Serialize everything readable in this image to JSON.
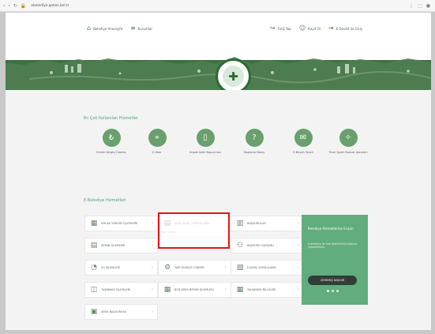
{
  "browser": {
    "url": "ebelediye.gebze.bel.tr",
    "icons": [
      "back-icon",
      "forward-icon",
      "refresh-icon",
      "lock-icon",
      "more-icon",
      "extensions-icon",
      "profile-icon"
    ]
  },
  "topnav": {
    "left": [
      {
        "label": "Belediye Anasayfa",
        "icon": "home-icon"
      },
      {
        "label": "Kurumlar",
        "icon": "menu-icon"
      }
    ],
    "right": [
      {
        "label": "Giriş Yap",
        "icon": "login-icon"
      },
      {
        "label": "Kayıt Ol",
        "icon": "user-plus-icon"
      },
      {
        "label": "E-Devlet ile Giriş",
        "icon": "edevlet-icon"
      }
    ]
  },
  "hero": {
    "seal_icon": "seal-logo-icon"
  },
  "sections": {
    "most_used_title": "En Çok Kullanılan Hizmetler",
    "ebelediye_title": "E-Belediye Hizmetleri"
  },
  "services": [
    {
      "label": "Emlak Vergisi Ödeme",
      "icon": "payment-icon"
    },
    {
      "label": "E-İmar",
      "icon": "location-icon"
    },
    {
      "label": "İnşaat İşleri Başvurusu",
      "icon": "document-icon"
    },
    {
      "label": "Başkana Danış",
      "icon": "question-icon"
    },
    {
      "label": "E-Beyan Tahsil",
      "icon": "chat-icon"
    },
    {
      "label": "Ticari İşyeri Ruhsat İşlemleri",
      "icon": "business-icon"
    }
  ],
  "e_services": {
    "col1": [
      {
        "label": "EMLAK VERGİSİ İŞLEMLERİ",
        "icon": "building-icon"
      },
      {
        "label": "ZEMİN İŞLEMLERİ",
        "icon": "ground-icon"
      },
      {
        "label": "SU İŞLEMLERİ",
        "icon": "water-icon"
      },
      {
        "label": "TAŞINMAZ İŞLEMLERİ",
        "icon": "property-icon"
      },
      {
        "label": "ARSA BAŞVURUSU",
        "icon": "plot-icon"
      }
    ],
    "col2": [
      {
        "label": "ARSA BORÇ SORGULAMA",
        "icon": "debt-icon"
      },
      {
        "label": "YAPI RUHSATI ÖDEME",
        "icon": "building-permit-icon"
      },
      {
        "label": "BOŞ ARSA BEYAN İŞLEMLERİ",
        "icon": "declaration-icon"
      }
    ],
    "col3": [
      {
        "label": "BAŞVURULAR",
        "icon": "applications-icon"
      },
      {
        "label": "BAŞVURU DURUMU",
        "icon": "status-icon"
      },
      {
        "label": "E-BORÇ SORGULAMA",
        "icon": "search-debt-icon"
      },
      {
        "label": "TAHAKKUK BİLGİLERİ",
        "icon": "accrual-icon"
      }
    ],
    "dropdown_item": "Borç Ödeme"
  },
  "promo": {
    "title": "Belediye Hizmetlerine Erişim",
    "text": "E-belediye ile tüm işlemlerinizi kolayca yapabilirsiniz.",
    "button": "ÇEVRİMİÇİ BAŞVUR"
  },
  "colors": {
    "accent_green": "#55a17a",
    "dark_green": "#3d7144",
    "promo_green": "#62ad7d",
    "red_highlight": "#e21414"
  }
}
